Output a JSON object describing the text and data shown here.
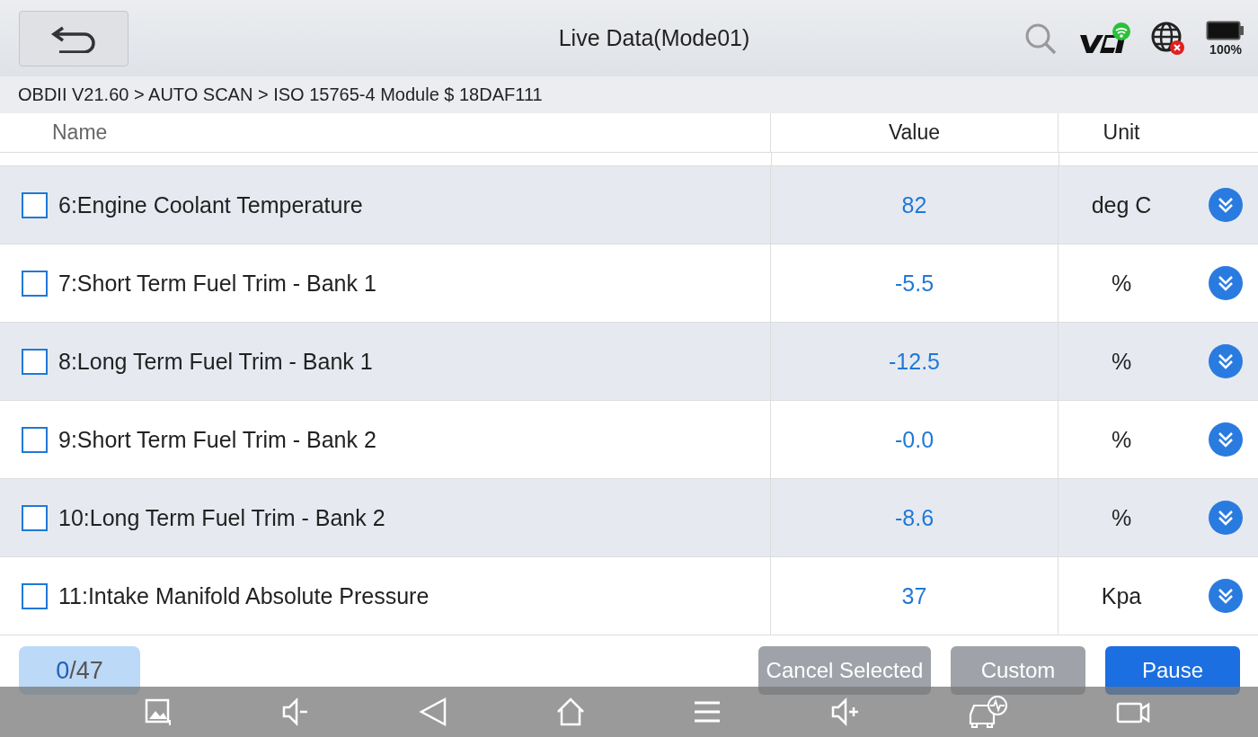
{
  "header": {
    "title": "Live Data(Mode01)",
    "battery": "100%"
  },
  "breadcrumb": "OBDII V21.60 > AUTO SCAN  > ISO 15765-4 Module $ 18DAF111",
  "table": {
    "columns": [
      "Name",
      "Value",
      "Unit"
    ],
    "rows": [
      {
        "name": "6:Engine Coolant Temperature",
        "value": "82",
        "unit": "deg C",
        "checked": false
      },
      {
        "name": "7:Short Term Fuel Trim - Bank 1",
        "value": "-5.5",
        "unit": "%",
        "checked": false
      },
      {
        "name": "8:Long Term Fuel Trim - Bank 1",
        "value": "-12.5",
        "unit": "%",
        "checked": false
      },
      {
        "name": "9:Short Term Fuel Trim - Bank 2",
        "value": "-0.0",
        "unit": "%",
        "checked": false
      },
      {
        "name": "10:Long Term Fuel Trim - Bank 2",
        "value": "-8.6",
        "unit": "%",
        "checked": false
      },
      {
        "name": "11:Intake Manifold Absolute Pressure",
        "value": "37",
        "unit": "Kpa",
        "checked": false
      }
    ]
  },
  "footer": {
    "count_selected": "0",
    "count_total": "/47",
    "buttons": [
      {
        "label": "Cancel Selected",
        "kind": "secondary"
      },
      {
        "label": "Custom",
        "kind": "secondary"
      },
      {
        "label": "Pause",
        "kind": "primary"
      }
    ]
  }
}
